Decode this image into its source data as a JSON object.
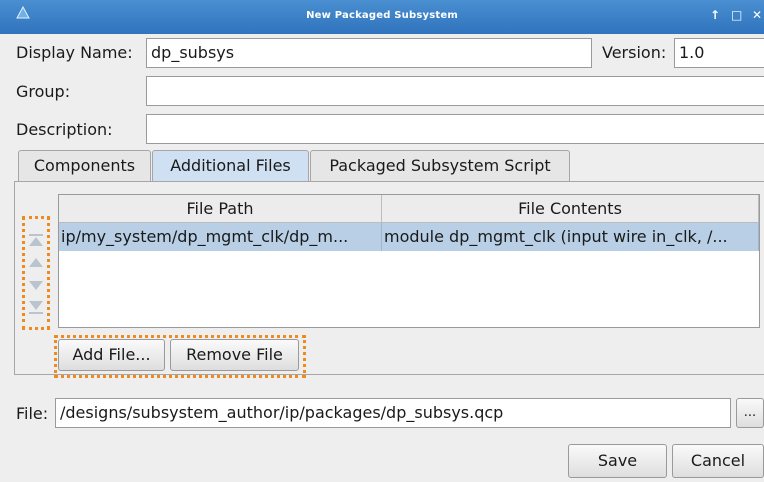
{
  "window": {
    "title": "New Packaged Subsystem"
  },
  "form": {
    "display_name_label": "Display Name:",
    "display_name_value": "dp_subsys",
    "version_label": "Version:",
    "version_value": "1.0",
    "group_label": "Group:",
    "group_value": "",
    "description_label": "Description:",
    "description_value": ""
  },
  "tabs": [
    {
      "label": "Components",
      "active": false
    },
    {
      "label": "Additional Files",
      "active": true
    },
    {
      "label": "Packaged Subsystem Script",
      "active": false
    }
  ],
  "table": {
    "columns": [
      "File Path",
      "File Contents"
    ],
    "rows": [
      {
        "path": "ip/my_system/dp_mgmt_clk/dp_m...",
        "contents": "module dp_mgmt_clk (input  wire  in_clk,  /...",
        "selected": true
      }
    ]
  },
  "move_controls": {
    "icons": [
      "move-top-icon",
      "move-up-icon",
      "move-down-icon",
      "move-bottom-icon"
    ]
  },
  "buttons": {
    "add_file": "Add File...",
    "remove_file": "Remove File",
    "browse": "...",
    "save": "Save",
    "cancel": "Cancel"
  },
  "file": {
    "label": "File:",
    "value": "/designs/subsystem_author/ip/packages/dp_subsys.qcp"
  },
  "colors": {
    "titlebar": "#2f74bd",
    "selection": "#b8cfe6",
    "highlight_outline": "#ee8a1e",
    "active_tab": "#cfe0f2"
  }
}
